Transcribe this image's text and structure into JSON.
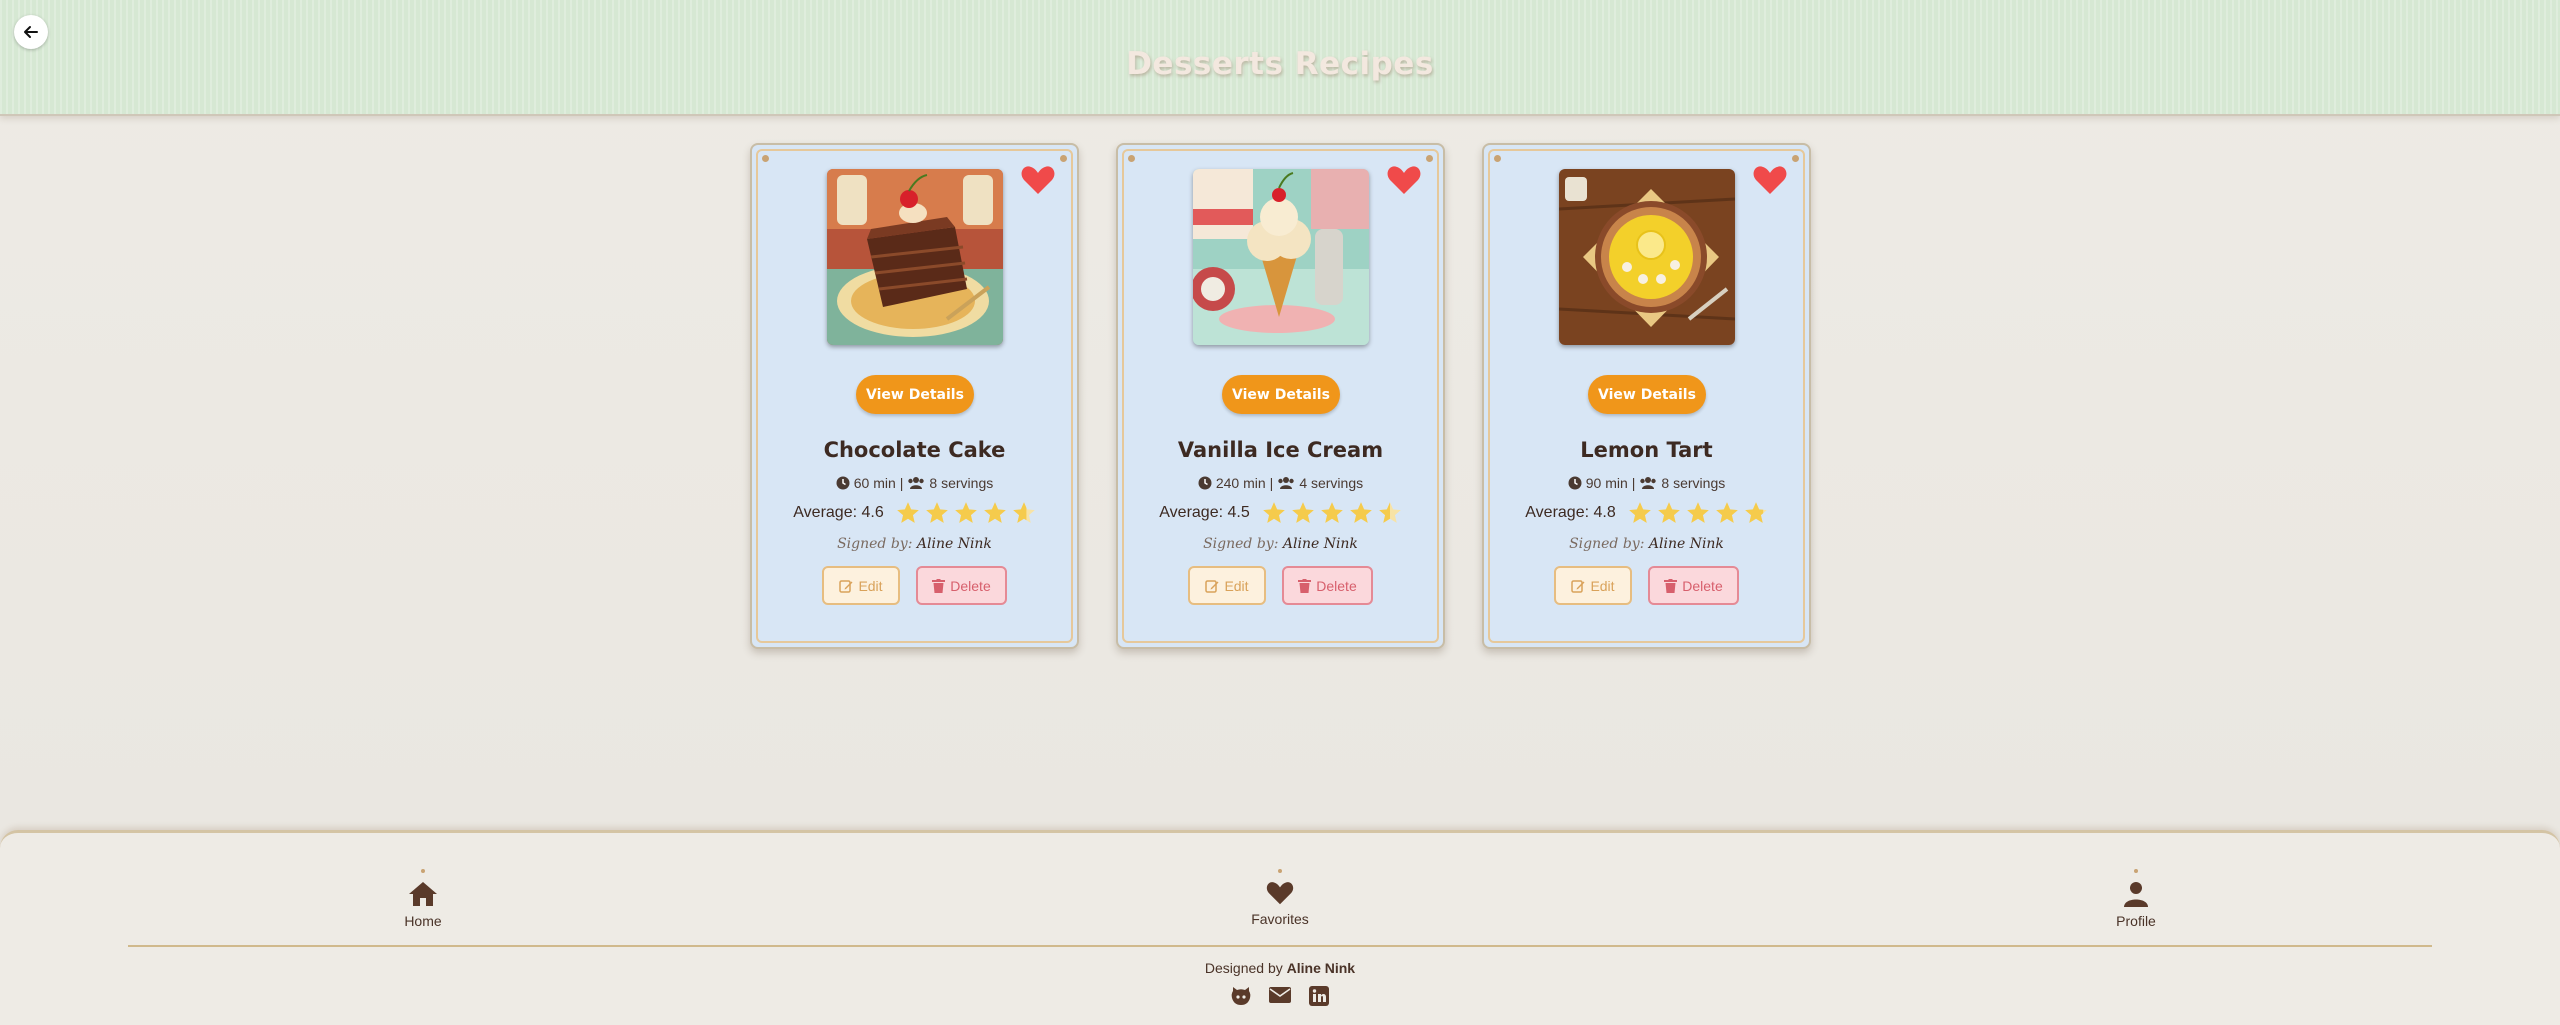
{
  "header": {
    "title": "Desserts Recipes",
    "back_icon": "arrow-left-icon"
  },
  "cards": [
    {
      "name": "Chocolate Cake",
      "image": "chocolate-cake-image",
      "view_label": "View Details",
      "time": "60 min",
      "servings": "8 servings",
      "average_label": "Average: 4.6",
      "average": 4.6,
      "signed_prefix": "Signed by:",
      "author": "Aline Nink",
      "edit_label": "Edit",
      "delete_label": "Delete",
      "favorite": true
    },
    {
      "name": "Vanilla Ice Cream",
      "image": "vanilla-ice-cream-image",
      "view_label": "View Details",
      "time": "240 min",
      "servings": "4 servings",
      "average_label": "Average: 4.5",
      "average": 4.5,
      "signed_prefix": "Signed by:",
      "author": "Aline Nink",
      "edit_label": "Edit",
      "delete_label": "Delete",
      "favorite": true
    },
    {
      "name": "Lemon Tart",
      "image": "lemon-tart-image",
      "view_label": "View Details",
      "time": "90 min",
      "servings": "8 servings",
      "average_label": "Average: 4.8",
      "average": 4.8,
      "signed_prefix": "Signed by:",
      "author": "Aline Nink",
      "edit_label": "Edit",
      "delete_label": "Delete",
      "favorite": true
    }
  ],
  "footer": {
    "nav": [
      {
        "label": "Home",
        "icon": "home-icon"
      },
      {
        "label": "Favorites",
        "icon": "heart-icon"
      },
      {
        "label": "Profile",
        "icon": "user-icon"
      }
    ],
    "designed_prefix": "Designed by",
    "designer": "Aline Nink",
    "socials": [
      "github-icon",
      "envelope-icon",
      "linkedin-icon"
    ]
  },
  "colors": {
    "header_bg": "#d6e8d3",
    "card_bg": "#d8e6f5",
    "accent": "#f0961a",
    "heart": "#f04a4a",
    "star": "#f5cb4c",
    "text": "#4a3328"
  }
}
